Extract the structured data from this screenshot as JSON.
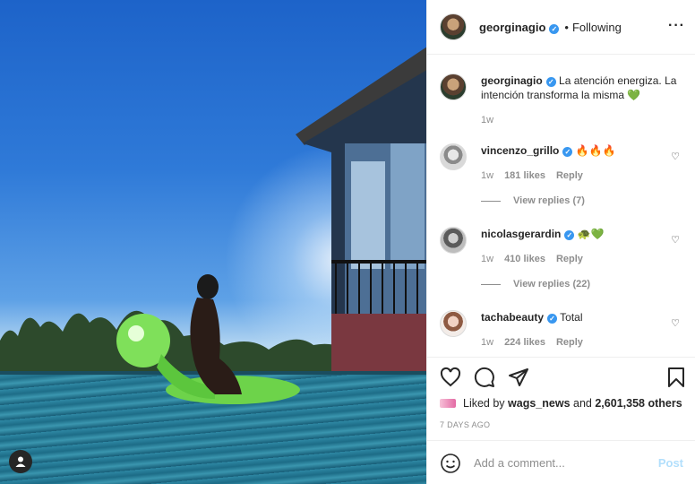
{
  "post": {
    "username": "georginagio",
    "follow_status": "Following",
    "more_icon": "more-horizontal-icon"
  },
  "caption": {
    "username": "georginagio",
    "text": "La atención energiza. La intención transforma la misma 💚",
    "time": "1w"
  },
  "comments": [
    {
      "username": "vincenzo_grillo",
      "text": "🔥🔥🔥",
      "time": "1w",
      "likes": "181 likes",
      "reply": "Reply",
      "view_replies": "View replies (7)"
    },
    {
      "username": "nicolasgerardin",
      "text": "🐢💚",
      "time": "1w",
      "likes": "410 likes",
      "reply": "Reply",
      "view_replies": "View replies (22)"
    },
    {
      "username": "tachabeauty",
      "text": "Total",
      "time": "1w",
      "likes": "224 likes",
      "reply": "Reply"
    }
  ],
  "actions": {
    "liked_by_prefix": "Liked by",
    "liked_by_user": "wags_news",
    "and": "and",
    "others": "2,601,358 others",
    "timestamp": "7 DAYS AGO"
  },
  "add_comment": {
    "placeholder": "Add a comment...",
    "post_label": "Post"
  },
  "colors": {
    "verified": "#3897f0",
    "post_button_disabled": "#b2dffc",
    "muted_text": "#8e8e8e"
  }
}
